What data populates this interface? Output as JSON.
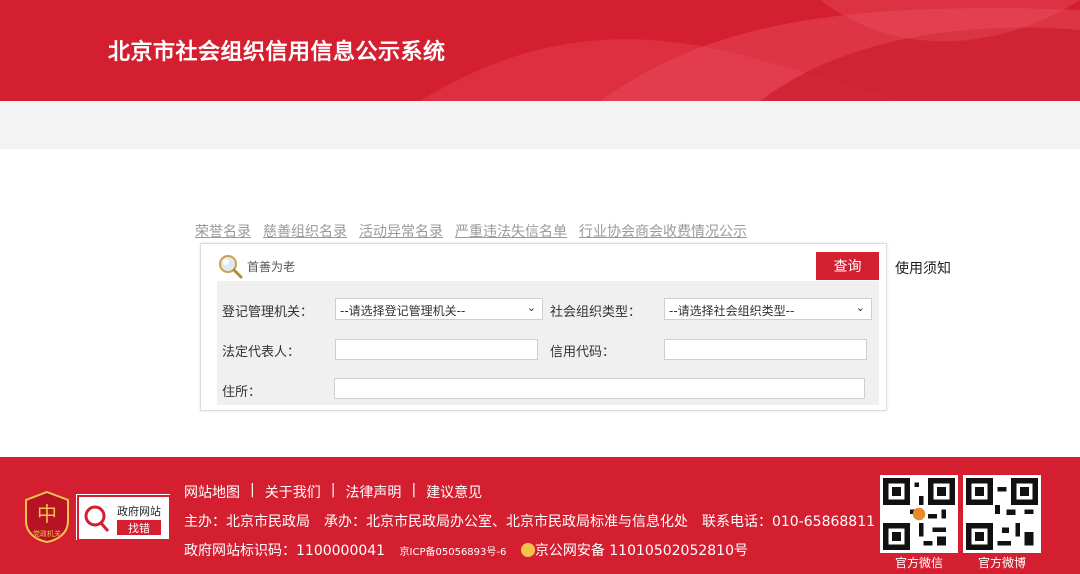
{
  "header": {
    "title": "北京市社会组织信用信息公示系统"
  },
  "tabs": [
    "荣誉名录",
    "慈善组织名录",
    "活动异常名录",
    "严重违法失信名单",
    "行业协会商会收费情况公示"
  ],
  "search": {
    "value": "首善为老",
    "button_label": "查询",
    "usage_label": "使用须知"
  },
  "form": {
    "reg_authority_label": "登记管理机关：",
    "reg_authority_value": "--请选择登记管理机关--",
    "org_type_label": "社会组织类型：",
    "org_type_value": "--请选择社会组织类型--",
    "legal_rep_label": "法定代表人：",
    "credit_code_label": "信用代码：",
    "address_label": "住所："
  },
  "footer": {
    "badge_text": "党政机关",
    "zhaocuo_top": "政府网站",
    "zhaocuo_bottom": "找错",
    "links": [
      "网站地图",
      "关于我们",
      "法律声明",
      "建议意见"
    ],
    "sep": "|",
    "host_line": "主办：北京市民政局　承办：北京市民政局办公室、北京市民政局标准与信息化处　联系电话：010-65868811",
    "id_label": "政府网站标识码：1100000041",
    "icp": "京ICP备05056893号-6",
    "police": "京公网安备 11010502052810号",
    "qr_wechat_label": "官方微信",
    "qr_weibo_label": "官方微博"
  },
  "colors": {
    "brand_red": "#d41f31",
    "link_gray": "#9a9a9a"
  }
}
